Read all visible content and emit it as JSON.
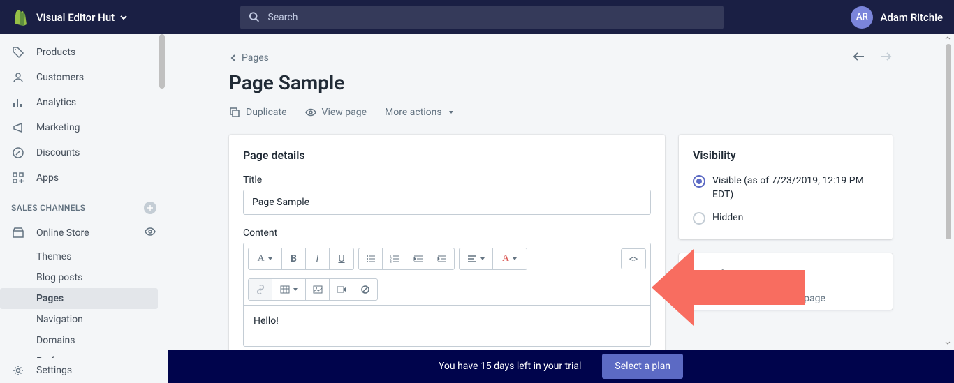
{
  "header": {
    "store_name": "Visual Editor Hut",
    "search_placeholder": "Search",
    "avatar_initials": "AR",
    "username": "Adam Ritchie"
  },
  "sidebar": {
    "nav": [
      {
        "icon": "tag",
        "label": "Products"
      },
      {
        "icon": "user",
        "label": "Customers"
      },
      {
        "icon": "bar-chart",
        "label": "Analytics"
      },
      {
        "icon": "megaphone",
        "label": "Marketing"
      },
      {
        "icon": "discount",
        "label": "Discounts"
      },
      {
        "icon": "apps",
        "label": "Apps"
      }
    ],
    "section_label": "SALES CHANNELS",
    "channel": {
      "label": "Online Store"
    },
    "subnav": [
      {
        "label": "Themes"
      },
      {
        "label": "Blog posts"
      },
      {
        "label": "Pages",
        "active": true
      },
      {
        "label": "Navigation"
      },
      {
        "label": "Domains"
      },
      {
        "label": "Preferences"
      }
    ],
    "settings_label": "Settings"
  },
  "page": {
    "breadcrumb": "Pages",
    "title": "Page Sample",
    "actions": {
      "duplicate": "Duplicate",
      "view": "View page",
      "more": "More actions"
    },
    "details": {
      "card_title": "Page details",
      "title_label": "Title",
      "title_value": "Page Sample",
      "content_label": "Content",
      "content_body": "Hello!"
    },
    "visibility": {
      "card_title": "Visibility",
      "visible_label": "Visible (as of 7/23/2019, 12:19 PM EDT)",
      "hidden_label": "Hidden"
    },
    "template": {
      "card_title": "Template",
      "hint": "Select a template for this page"
    }
  },
  "trial": {
    "message": "You have 15 days left in your trial",
    "button": "Select a plan"
  }
}
